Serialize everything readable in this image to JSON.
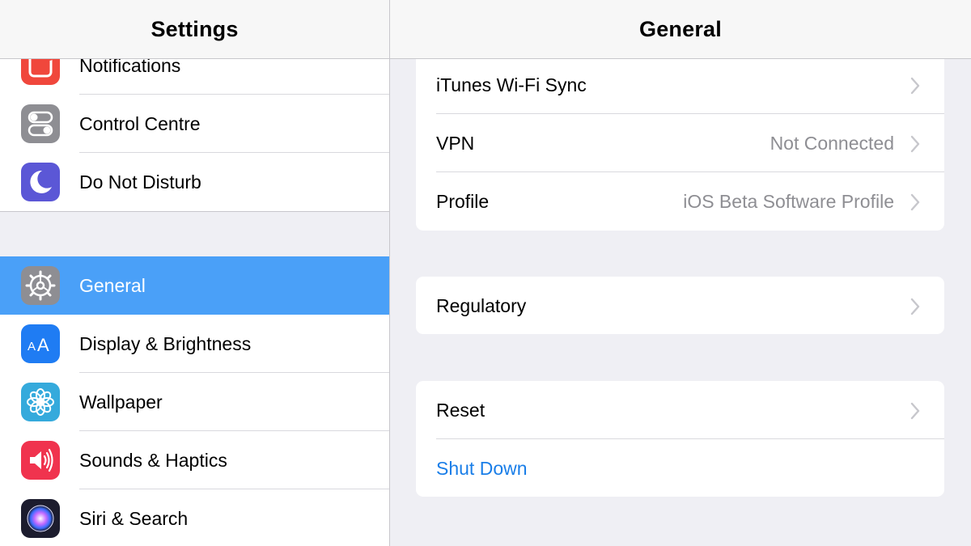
{
  "left": {
    "title": "Settings",
    "group1": [
      {
        "label": "Notifications",
        "icon": "notifications-icon",
        "color": "#f0473c"
      },
      {
        "label": "Control Centre",
        "icon": "control-centre-icon",
        "color": "#8e8e93"
      },
      {
        "label": "Do Not Disturb",
        "icon": "moon-icon",
        "color": "#5b57d6"
      }
    ],
    "group2": [
      {
        "label": "General",
        "icon": "gear-icon",
        "color": "#8e8e93",
        "selected": true
      },
      {
        "label": "Display & Brightness",
        "icon": "display-brightness-icon",
        "color": "#1f7cf3"
      },
      {
        "label": "Wallpaper",
        "icon": "wallpaper-flower-icon",
        "color": "#35aadc"
      },
      {
        "label": "Sounds & Haptics",
        "icon": "speaker-icon",
        "color": "#f0334e"
      },
      {
        "label": "Siri & Search",
        "icon": "siri-icon",
        "color": "#1c1c2e"
      }
    ]
  },
  "right": {
    "title": "General",
    "section1": [
      {
        "label": "iTunes Wi-Fi Sync",
        "value": ""
      },
      {
        "label": "VPN",
        "value": "Not Connected"
      },
      {
        "label": "Profile",
        "value": "iOS Beta Software Profile"
      }
    ],
    "section2": [
      {
        "label": "Regulatory",
        "value": ""
      }
    ],
    "section3": [
      {
        "label": "Reset",
        "value": ""
      },
      {
        "label": "Shut Down",
        "value": "",
        "action": true
      }
    ]
  },
  "colors": {
    "selected_row": "#4aa0f8",
    "action_text": "#1a7ee8",
    "secondary_text": "#8e8e93",
    "background": "#efeff4"
  }
}
